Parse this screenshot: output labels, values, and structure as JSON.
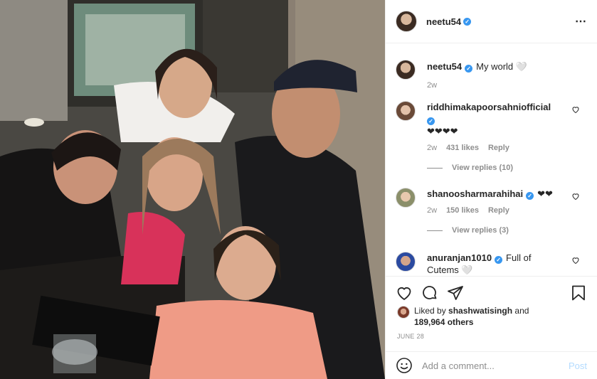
{
  "post": {
    "author": "neetu54",
    "verified_mark": "✓",
    "more_icon": "⋯",
    "caption_text": "My world 🤍",
    "caption_time": "2w"
  },
  "comments": [
    {
      "user": "riddhimakapoorsahniofficial",
      "text": "❤❤❤❤",
      "time": "2w",
      "likes": "431 likes",
      "reply": "Reply",
      "view_replies": "View replies (10)"
    },
    {
      "user": "shanoosharmarahihai",
      "text": "❤❤",
      "time": "2w",
      "likes": "150 likes",
      "reply": "Reply",
      "view_replies": "View replies (3)"
    },
    {
      "user": "anuranjan1010",
      "text": "Full of Cutems 🤍"
    }
  ],
  "liked_by": {
    "prefix": "Liked by ",
    "user": "shashwatisingh",
    "and": " and",
    "count": "189,964 others"
  },
  "date": "JUNE 28",
  "add_comment": {
    "placeholder": "Add a comment...",
    "post_label": "Post"
  },
  "icons": {
    "heart": "heart-icon",
    "comment": "comment-icon",
    "share": "share-icon",
    "save": "bookmark-icon",
    "emoji": "emoji-icon"
  },
  "colors": {
    "verified": "#3897f0",
    "muted": "#8e8e8e",
    "post_disabled": "#b3dbff"
  }
}
